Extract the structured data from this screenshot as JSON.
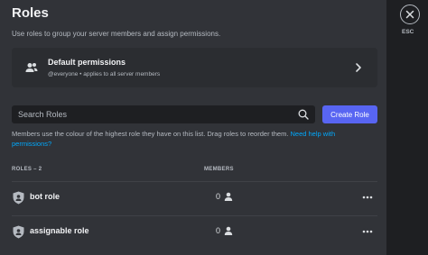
{
  "header": {
    "title": "Roles",
    "subtitle": "Use roles to group your server members and assign permissions."
  },
  "default_permissions": {
    "icon": "members-icon",
    "name": "Default permissions",
    "description": "@everyone • applies to all server members",
    "chevron": "chevron-right-icon"
  },
  "search": {
    "placeholder": "Search Roles",
    "value": "",
    "icon": "search-icon"
  },
  "create_role_label": "Create Role",
  "help": {
    "text": "Members use the colour of the highest role they have on this list. Drag roles to reorder them.",
    "link": "Need help with permissions?"
  },
  "table": {
    "roles_header": "ROLES – 2",
    "members_header": "MEMBERS",
    "rows": [
      {
        "name": "bot role",
        "members": "0",
        "icon": "shield-icon"
      },
      {
        "name": "assignable role",
        "members": "0",
        "icon": "shield-icon"
      }
    ]
  },
  "close": {
    "icon": "close-icon",
    "label": "ESC"
  },
  "colors": {
    "background": "#313338",
    "sidebar": "#1e1f22",
    "accent": "#5865f2",
    "link": "#00a8fc"
  }
}
